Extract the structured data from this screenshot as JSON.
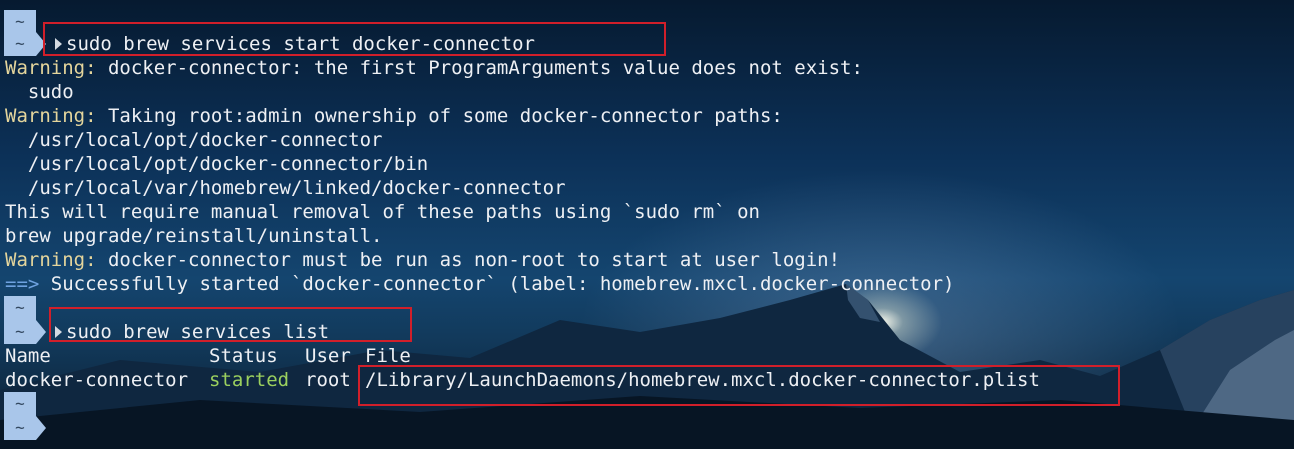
{
  "prompt": {
    "tilde": "~"
  },
  "commands": {
    "start": "sudo brew services start docker-connector",
    "list": "sudo brew services list"
  },
  "output": {
    "warn_label": "Warning:",
    "w1_text": " docker-connector: the first ProgramArguments value does not exist:",
    "w1_detail": "  sudo",
    "w2_text": " Taking root:admin ownership of some docker-connector paths:",
    "paths": [
      "  /usr/local/opt/docker-connector",
      "  /usr/local/opt/docker-connector/bin",
      "  /usr/local/var/homebrew/linked/docker-connector"
    ],
    "note1": "This will require manual removal of these paths using `sudo rm` on",
    "note2": "brew upgrade/reinstall/uninstall.",
    "w3_text": " docker-connector must be run as non-root to start at user login!",
    "success_arrow": "==>",
    "success_text": " Successfully started `docker-connector` (label: homebrew.mxcl.docker-connector)"
  },
  "service_table": {
    "headers": [
      "Name",
      "Status",
      "User",
      "File"
    ],
    "rows": [
      {
        "name": "docker-connector",
        "status": "started",
        "user": "root",
        "file": "/Library/LaunchDaemons/homebrew.mxcl.docker-connector.plist"
      }
    ]
  },
  "colors": {
    "warning": "#e4d59c",
    "started": "#9bd05e",
    "arrow": "#6fa2e0",
    "highlight": "#d11f2a",
    "prompt": "#a9c6ea"
  }
}
